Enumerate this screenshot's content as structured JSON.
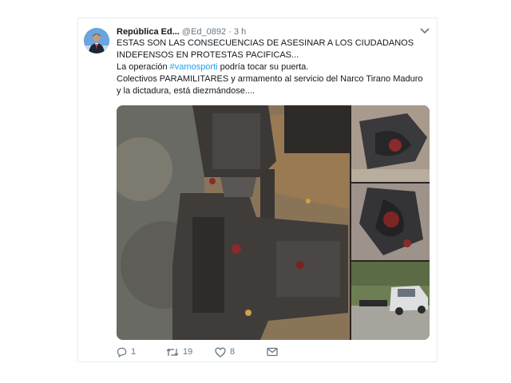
{
  "tweet": {
    "display_name": "República Ed...",
    "handle": "@Ed_0892",
    "separator": "·",
    "time": "3 h",
    "text_lines": [
      "ESTAS SON LAS CONSECUENCIAS DE ASESINAR A LOS CIUDADANOS INDEFENSOS EN PROTESTAS PACIFICAS...",
      "La operación",
      "podría tocar su puerta.",
      "Colectivos PARAMILITARES y armamento al servicio del Narco Tirano Maduro y la dictadura, está diezmándose...."
    ],
    "hashtag": "#vamosporti",
    "media": [
      {
        "icon": "weapon-photo"
      },
      {
        "icon": "bodies-photo"
      },
      {
        "icon": "bodies-photo"
      },
      {
        "icon": "car-photo"
      }
    ],
    "actions": {
      "reply_icon": "reply-icon",
      "reply_count": "1",
      "retweet_icon": "retweet-icon",
      "retweet_count": "19",
      "like_icon": "heart-icon",
      "like_count": "8",
      "dm_icon": "direct-message-icon"
    },
    "colors": {
      "hashtag": "#1da1f2",
      "text": "#14171a",
      "muted": "#657786"
    }
  }
}
